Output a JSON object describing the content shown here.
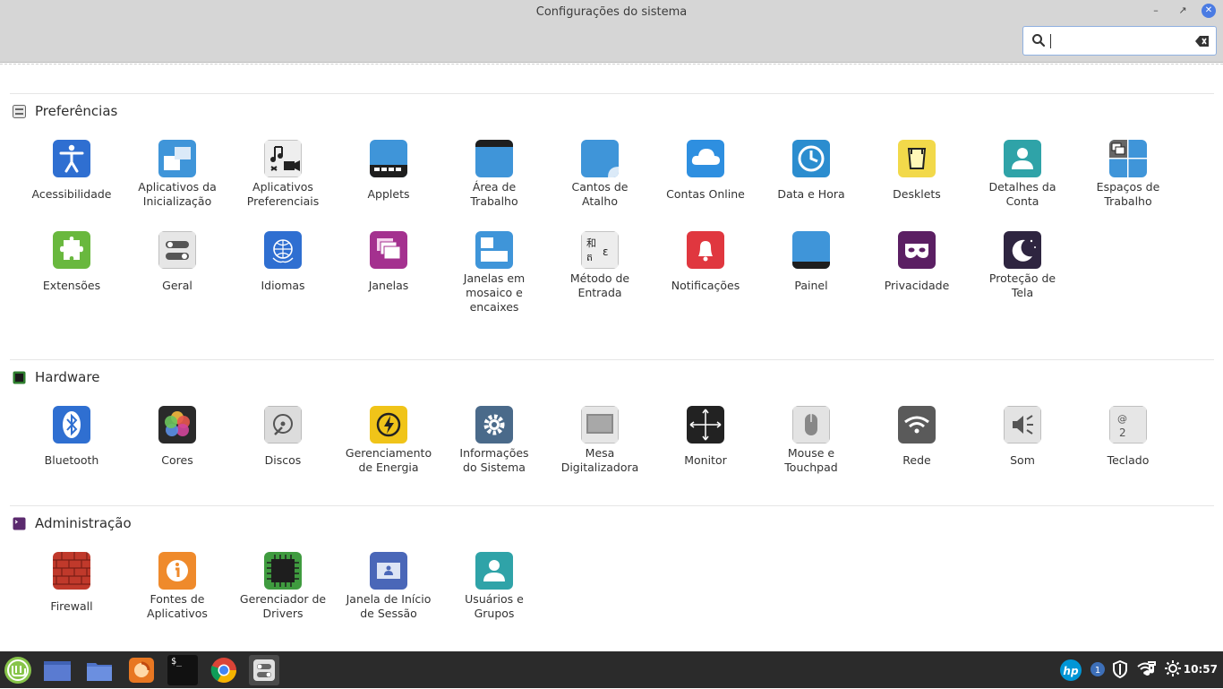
{
  "window": {
    "title": "Configurações do sistema",
    "search": {
      "value": "",
      "placeholder": ""
    }
  },
  "sections": [
    {
      "label": "Preferências",
      "items": [
        {
          "label": "Acessibilidade",
          "icon": "accessibility-icon"
        },
        {
          "label": "Aplicativos da\nInicialização",
          "icon": "startup-apps-icon"
        },
        {
          "label": "Aplicativos\nPreferenciais",
          "icon": "preferred-apps-icon"
        },
        {
          "label": "Applets",
          "icon": "applets-icon"
        },
        {
          "label": "Área de\nTrabalho",
          "icon": "desktop-icon"
        },
        {
          "label": "Cantos de\nAtalho",
          "icon": "hot-corners-icon"
        },
        {
          "label": "Contas Online",
          "icon": "online-accounts-icon"
        },
        {
          "label": "Data e Hora",
          "icon": "clock-icon"
        },
        {
          "label": "Desklets",
          "icon": "desklets-icon"
        },
        {
          "label": "Detalhes da\nConta",
          "icon": "account-icon"
        },
        {
          "label": "Espaços de\nTrabalho",
          "icon": "workspaces-icon"
        },
        {
          "label": "Extensões",
          "icon": "puzzle-icon"
        },
        {
          "label": "Geral",
          "icon": "toggle-icon"
        },
        {
          "label": "Idiomas",
          "icon": "globe-icon"
        },
        {
          "label": "Janelas",
          "icon": "windows-icon"
        },
        {
          "label": "Janelas em\nmosaico e\nencaixes",
          "icon": "tiling-icon"
        },
        {
          "label": "Método de\nEntrada",
          "icon": "input-method-icon"
        },
        {
          "label": "Notificações",
          "icon": "bell-icon"
        },
        {
          "label": "Painel",
          "icon": "panel-icon"
        },
        {
          "label": "Privacidade",
          "icon": "mask-icon"
        },
        {
          "label": "Proteção de\nTela",
          "icon": "moon-icon"
        }
      ]
    },
    {
      "label": "Hardware",
      "items": [
        {
          "label": "Bluetooth",
          "icon": "bluetooth-icon"
        },
        {
          "label": "Cores",
          "icon": "color-icon"
        },
        {
          "label": "Discos",
          "icon": "disk-icon"
        },
        {
          "label": "Gerenciamento\nde Energia",
          "icon": "power-icon"
        },
        {
          "label": "Informações\ndo Sistema",
          "icon": "gear-icon"
        },
        {
          "label": "Mesa\nDigitalizadora",
          "icon": "tablet-icon"
        },
        {
          "label": "Monitor",
          "icon": "monitor-icon"
        },
        {
          "label": "Mouse e\nTouchpad",
          "icon": "mouse-icon"
        },
        {
          "label": "Rede",
          "icon": "wifi-icon"
        },
        {
          "label": "Som",
          "icon": "speaker-icon"
        },
        {
          "label": "Teclado",
          "icon": "keyboard-icon"
        }
      ]
    },
    {
      "label": "Administração",
      "items": [
        {
          "label": "Firewall",
          "icon": "firewall-icon"
        },
        {
          "label": "Fontes de\nAplicativos",
          "icon": "info-icon"
        },
        {
          "label": "Gerenciador de\nDrivers",
          "icon": "chip-icon"
        },
        {
          "label": "Janela de Início\nde Sessão",
          "icon": "login-window-icon"
        },
        {
          "label": "Usuários e\nGrupos",
          "icon": "users-icon"
        }
      ]
    }
  ],
  "taskbar": {
    "clock": "10:57",
    "terminal_glyph": "$_",
    "hp_label": "hp",
    "update_badge": "1"
  }
}
